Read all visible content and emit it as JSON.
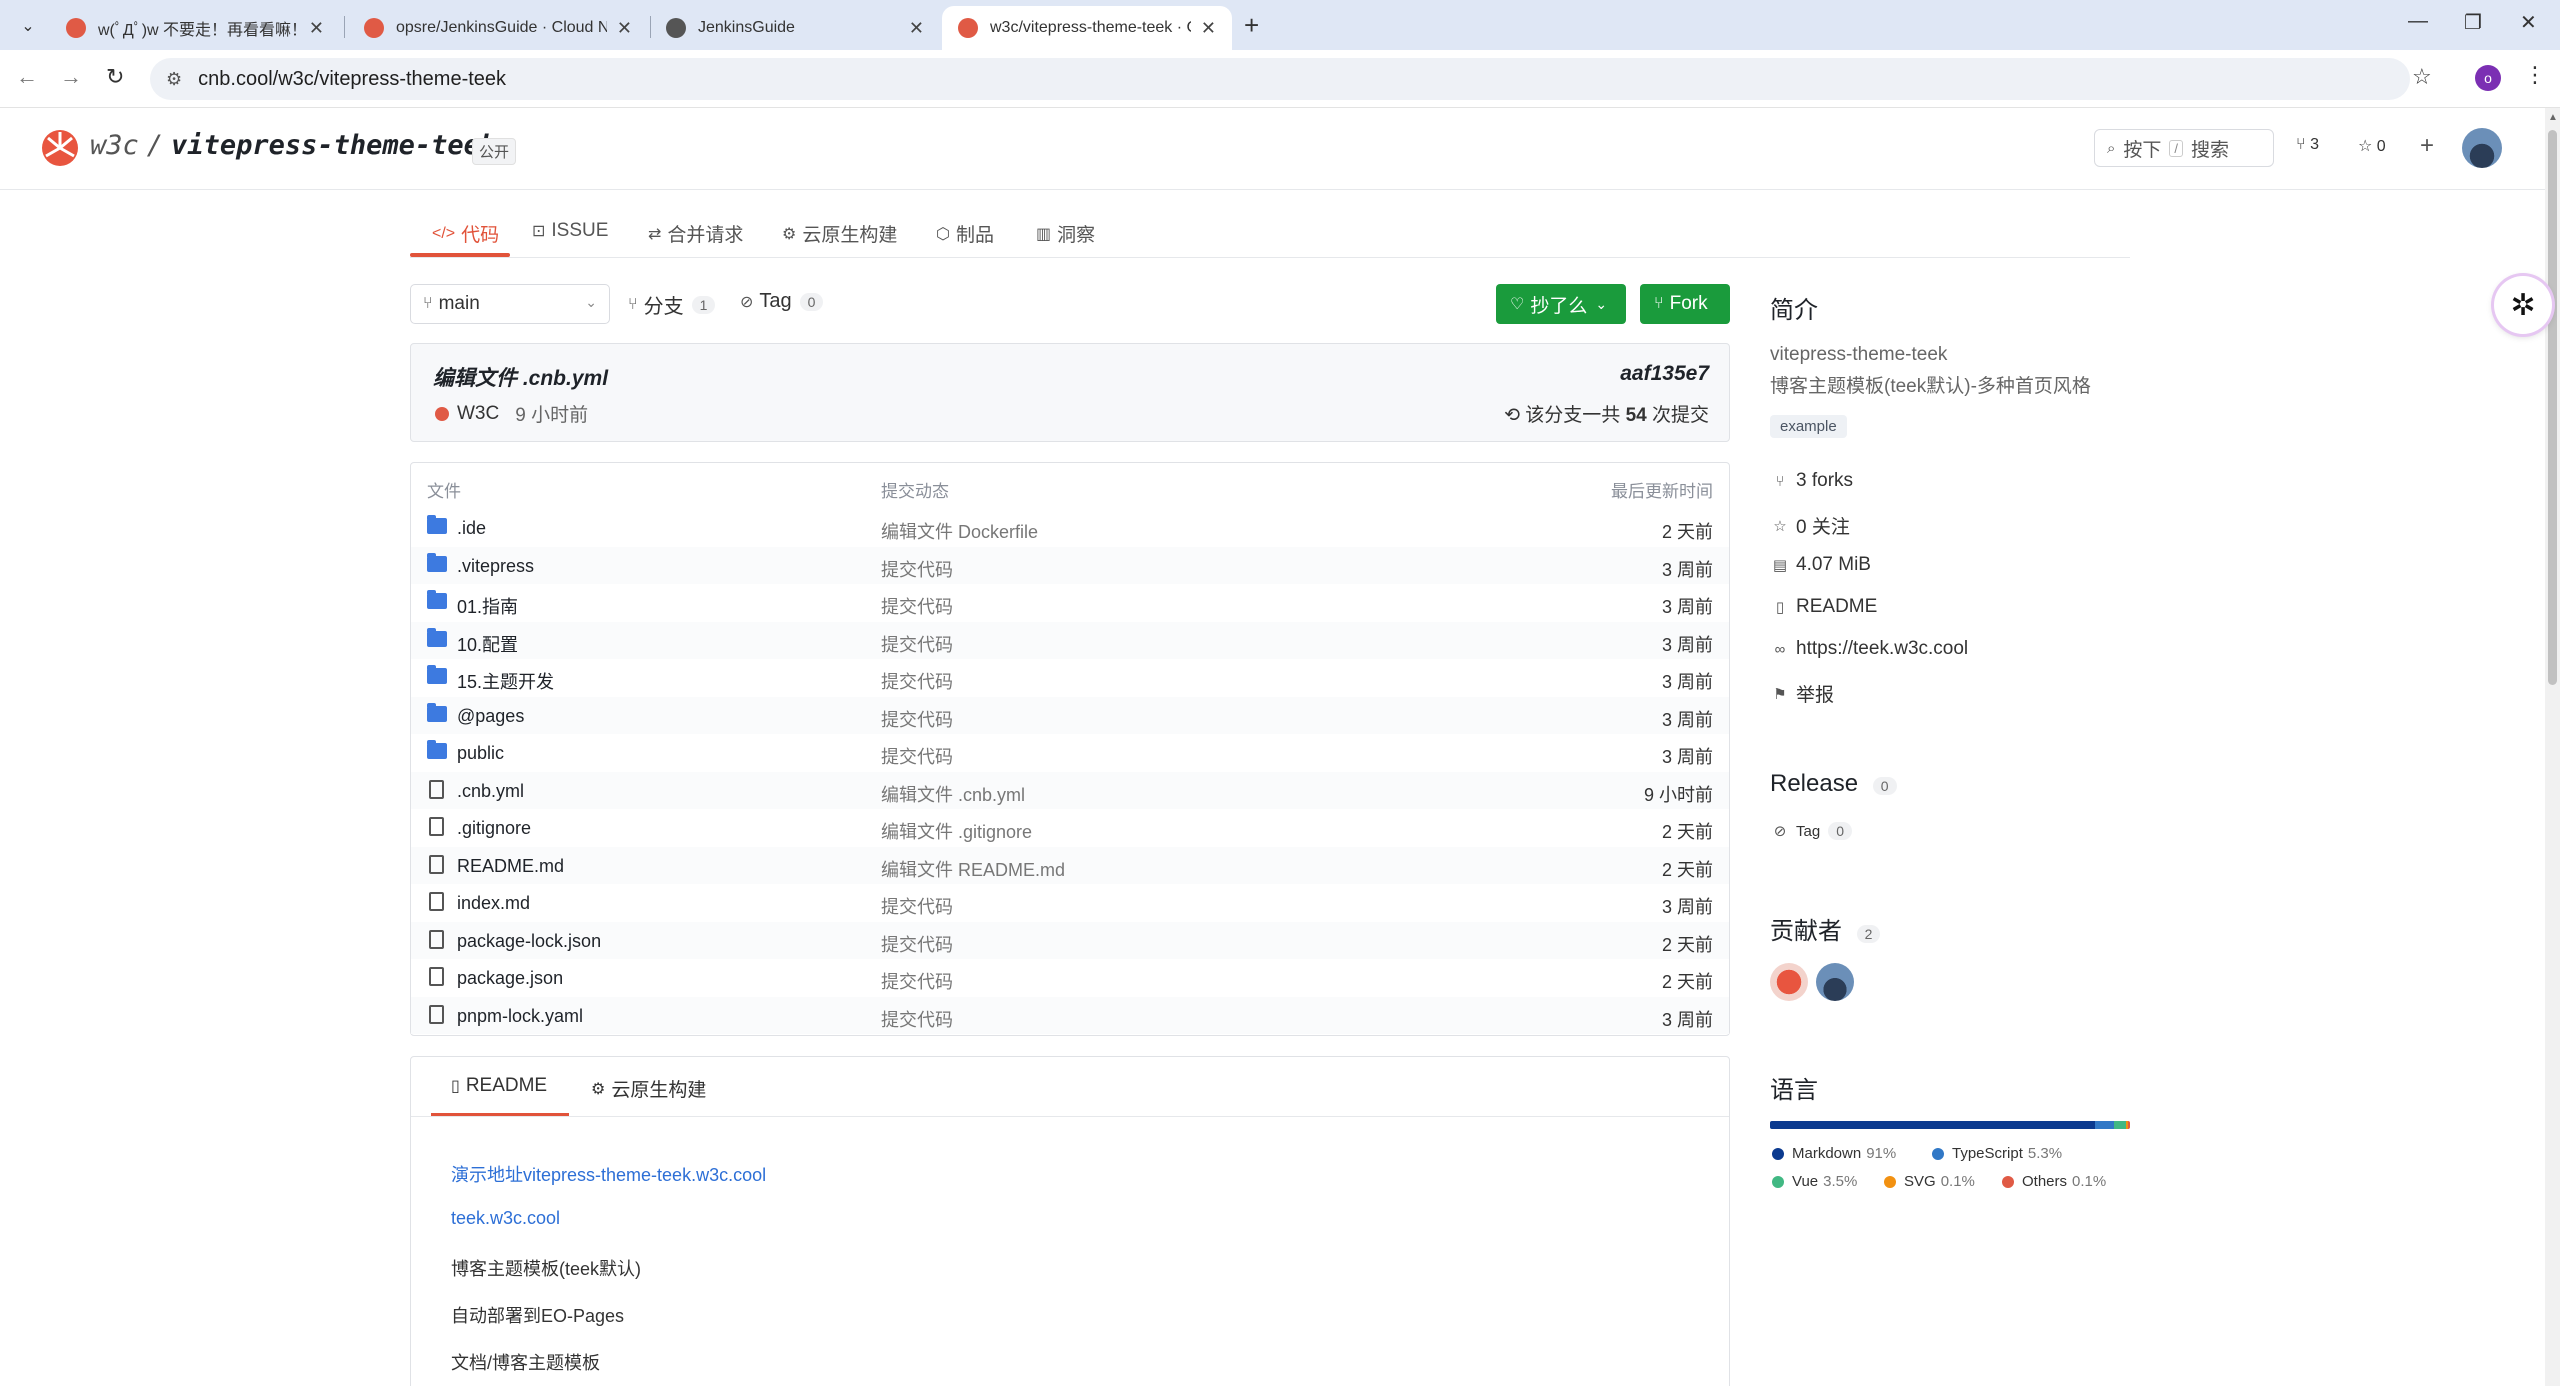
{
  "browser": {
    "tabs": [
      {
        "title": "w(ﾟДﾟ)w 不要走！再看看嘛！",
        "active": false
      },
      {
        "title": "opsre/JenkinsGuide · Cloud N",
        "active": false
      },
      {
        "title": "JenkinsGuide",
        "active": false
      },
      {
        "title": "w3c/vitepress-theme-teek · C",
        "active": true
      }
    ],
    "url": "cnb.cool/w3c/vitepress-theme-teek",
    "profile_initial": "o"
  },
  "header": {
    "owner": "w3c",
    "repo": "vitepress-theme-teek",
    "visibility": "公开",
    "search_prefix": "按下",
    "search_key": "/",
    "search_label": "搜索",
    "forks": "3",
    "stars": "0"
  },
  "repo_tabs": [
    {
      "label": "代码",
      "icon": "code-icon"
    },
    {
      "label": "ISSUE",
      "icon": "issue-icon"
    },
    {
      "label": "合并请求",
      "icon": "merge-icon"
    },
    {
      "label": "云原生构建",
      "icon": "build-icon"
    },
    {
      "label": "制品",
      "icon": "package-icon"
    },
    {
      "label": "洞察",
      "icon": "chart-icon"
    }
  ],
  "branch": {
    "current": "main",
    "branches_label": "分支",
    "branches_count": "1",
    "tags_label": "Tag",
    "tags_count": "0",
    "star_button": "抄了么",
    "fork_button": "Fork"
  },
  "commit": {
    "title": "编辑文件 .cnb.yml",
    "hash": "aaf135e7",
    "author": "W3C",
    "time": "9 小时前",
    "total_prefix": "该分支一共",
    "total_count": "54",
    "total_suffix": "次提交"
  },
  "files": {
    "headers": {
      "name": "文件",
      "message": "提交动态",
      "updated": "最后更新时间"
    },
    "rows": [
      {
        "name": ".ide",
        "type": "folder",
        "message": "编辑文件 Dockerfile",
        "time": "2 天前"
      },
      {
        "name": ".vitepress",
        "type": "folder",
        "message": "提交代码",
        "time": "3 周前"
      },
      {
        "name": "01.指南",
        "type": "folder",
        "message": "提交代码",
        "time": "3 周前"
      },
      {
        "name": "10.配置",
        "type": "folder",
        "message": "提交代码",
        "time": "3 周前"
      },
      {
        "name": "15.主题开发",
        "type": "folder",
        "message": "提交代码",
        "time": "3 周前"
      },
      {
        "name": "@pages",
        "type": "folder",
        "message": "提交代码",
        "time": "3 周前"
      },
      {
        "name": "public",
        "type": "folder",
        "message": "提交代码",
        "time": "3 周前"
      },
      {
        "name": ".cnb.yml",
        "type": "file",
        "message": "编辑文件 .cnb.yml",
        "time": "9 小时前"
      },
      {
        "name": ".gitignore",
        "type": "file",
        "message": "编辑文件 .gitignore",
        "time": "2 天前"
      },
      {
        "name": "README.md",
        "type": "file",
        "message": "编辑文件 README.md",
        "time": "2 天前"
      },
      {
        "name": "index.md",
        "type": "file",
        "message": "提交代码",
        "time": "3 周前"
      },
      {
        "name": "package-lock.json",
        "type": "file",
        "message": "提交代码",
        "time": "2 天前"
      },
      {
        "name": "package.json",
        "type": "file",
        "message": "提交代码",
        "time": "2 天前"
      },
      {
        "name": "pnpm-lock.yaml",
        "type": "file",
        "message": "提交代码",
        "time": "3 周前"
      }
    ]
  },
  "readme": {
    "tabs": [
      "README",
      "云原生构建"
    ],
    "lines": [
      {
        "text": "演示地址vitepress-theme-teek.w3c.cool",
        "link": true
      },
      {
        "text": "teek.w3c.cool",
        "link": true
      },
      {
        "text": "博客主题模板(teek默认)",
        "link": false
      },
      {
        "text": "自动部署到EO-Pages",
        "link": false
      },
      {
        "text": "文档/博客主题模板",
        "link": false
      }
    ]
  },
  "sidebar": {
    "intro_title": "简介",
    "name": "vitepress-theme-teek",
    "description": "博客主题模板(teek默认)-多种首页风格",
    "topic": "example",
    "stats": [
      {
        "icon": "fork-icon",
        "text": "3 forks"
      },
      {
        "icon": "star-icon",
        "text": "0 关注"
      },
      {
        "icon": "disk-icon",
        "text": "4.07 MiB"
      },
      {
        "icon": "book-icon",
        "text": "README"
      },
      {
        "icon": "link-icon",
        "text": "https://teek.w3c.cool"
      },
      {
        "icon": "flag-icon",
        "text": "举报"
      }
    ],
    "release_title": "Release",
    "release_count": "0",
    "release_tag_label": "Tag",
    "release_tag_count": "0",
    "contributors_title": "贡献者",
    "contributors_count": "2",
    "languages_title": "语言",
    "languages": [
      {
        "name": "Markdown",
        "pct": "91%",
        "value": 91,
        "color": "#0b3a8f"
      },
      {
        "name": "TypeScript",
        "pct": "5.3%",
        "value": 5.3,
        "color": "#3178c6"
      },
      {
        "name": "Vue",
        "pct": "3.5%",
        "value": 3.5,
        "color": "#41b883"
      },
      {
        "name": "SVG",
        "pct": "0.1%",
        "value": 0.1,
        "color": "#f29111"
      },
      {
        "name": "Others",
        "pct": "0.1%",
        "value": 0.1,
        "color": "#e05a45"
      }
    ]
  }
}
